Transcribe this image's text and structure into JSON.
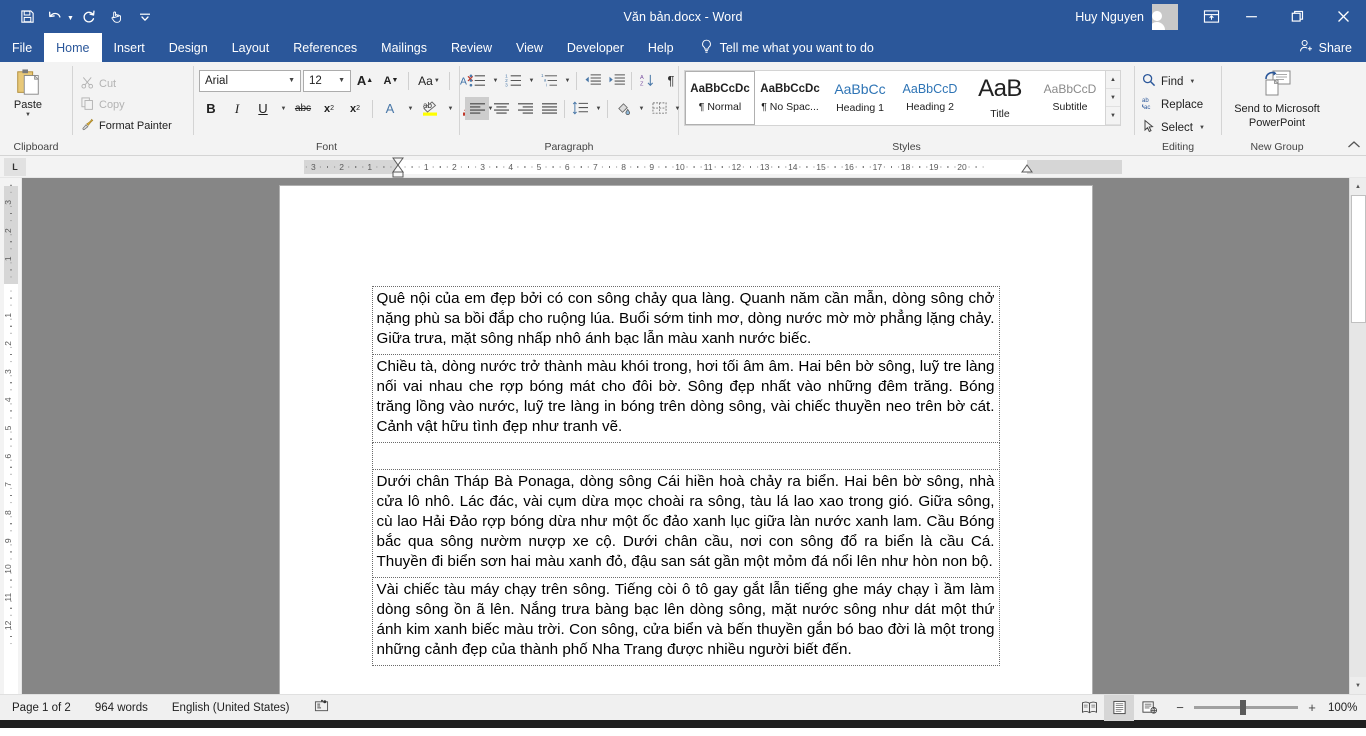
{
  "titlebar": {
    "quick_access": [
      {
        "name": "save-icon",
        "label": "Save"
      },
      {
        "name": "undo-icon",
        "label": "Undo"
      },
      {
        "name": "redo-icon",
        "label": "Redo"
      },
      {
        "name": "touch-mode-icon",
        "label": "Touch/Mouse Mode"
      },
      {
        "name": "customize-qat-icon",
        "label": "Customize Quick Access Toolbar"
      }
    ],
    "document_title": "Văn bản.docx  -  Word",
    "account_name": "Huy Nguyen",
    "ribbon_display_options": "Ribbon Display Options",
    "minimize": "Minimize",
    "restore": "Restore Down",
    "close": "Close"
  },
  "tabs": [
    {
      "label": "File",
      "active": false
    },
    {
      "label": "Home",
      "active": true
    },
    {
      "label": "Insert",
      "active": false
    },
    {
      "label": "Design",
      "active": false
    },
    {
      "label": "Layout",
      "active": false
    },
    {
      "label": "References",
      "active": false
    },
    {
      "label": "Mailings",
      "active": false
    },
    {
      "label": "Review",
      "active": false
    },
    {
      "label": "View",
      "active": false
    },
    {
      "label": "Developer",
      "active": false
    },
    {
      "label": "Help",
      "active": false
    }
  ],
  "tell_me": "Tell me what you want to do",
  "share": "Share",
  "ribbon": {
    "clipboard": {
      "group_label": "Clipboard",
      "paste_label": "Paste",
      "items": [
        {
          "label": "Cut",
          "enabled": false
        },
        {
          "label": "Copy",
          "enabled": false
        },
        {
          "label": "Format Painter",
          "enabled": true
        }
      ]
    },
    "font": {
      "group_label": "Font",
      "font_name": "Arial",
      "font_size": "12",
      "buttons_row1": [
        "Increase Font Size",
        "Decrease Font Size",
        "Change Case",
        "Clear All Formatting"
      ],
      "buttons_row2": [
        "Bold",
        "Italic",
        "Underline",
        "Strikethrough",
        "Subscript",
        "Superscript",
        "Text Effects and Typography",
        "Text Highlight Color",
        "Font Color"
      ],
      "bold_label": "B",
      "italic_label": "I",
      "underline_label": "U",
      "strike_label": "abc",
      "sub_label": "x",
      "sub_sup": "2",
      "super_label": "x",
      "super_sup": "2",
      "grow_label": "A",
      "shrink_label": "A",
      "case_label": "Aa",
      "effects_label": "A",
      "highlight_label": "ab",
      "color_label": "A"
    },
    "paragraph": {
      "group_label": "Paragraph",
      "buttons_row1": [
        "Bullets",
        "Numbering",
        "Multilevel List",
        "Decrease Indent",
        "Increase Indent",
        "Sort",
        "Show/Hide Formatting Marks"
      ],
      "buttons_row2": [
        "Align Left",
        "Center",
        "Align Right",
        "Justify",
        "Line and Paragraph Spacing",
        "Shading",
        "Borders"
      ],
      "pilcrow": "¶"
    },
    "styles": {
      "group_label": "Styles",
      "gallery": [
        {
          "preview": "AaBbCcDc",
          "name": "¶ Normal",
          "active": true,
          "style": "normal"
        },
        {
          "preview": "AaBbCcDc",
          "name": "¶ No Spac...",
          "active": false,
          "style": "nospace"
        },
        {
          "preview": "AaBbCc",
          "name": "Heading 1",
          "active": false,
          "style": "h1"
        },
        {
          "preview": "AaBbCcD",
          "name": "Heading 2",
          "active": false,
          "style": "h2"
        },
        {
          "preview": "AaB",
          "name": "Title",
          "active": false,
          "style": "title"
        },
        {
          "preview": "AaBbCcD",
          "name": "Subtitle",
          "active": false,
          "style": "subtitle"
        }
      ]
    },
    "editing": {
      "group_label": "Editing",
      "items": [
        {
          "label": "Find",
          "icon": "magnifier-icon",
          "caret": true
        },
        {
          "label": "Replace",
          "icon": "replace-icon",
          "caret": false
        },
        {
          "label": "Select",
          "icon": "cursor-icon",
          "caret": true
        }
      ]
    },
    "new_group": {
      "group_label": "New Group",
      "button_label": "Send to Microsoft PowerPoint"
    },
    "collapse_label": "Collapse the Ribbon"
  },
  "ruler": {
    "tab_stop_marker": "L",
    "horizontal_ticks": [
      "2",
      "1",
      "1",
      "2",
      "3",
      "4",
      "5",
      "6",
      "7",
      "8",
      "9",
      "10",
      "11",
      "12",
      "13",
      "14",
      "15",
      "16",
      "17",
      "18",
      "19"
    ],
    "vertical_ticks": [
      "2",
      "1",
      "1",
      "2",
      "3",
      "4",
      "5",
      "6",
      "7",
      "8",
      "9",
      "10"
    ]
  },
  "document": {
    "paragraphs": [
      {
        "id": "p1",
        "text": "Quê nội của em đẹp bởi có con sông chảy qua làng. Quanh năm cần mẫn, dòng sông chở nặng phù sa bồi đắp cho ruộng lúa. Buổi sớm tinh mơ, dòng nước mờ mờ phẳng lặng chảy. Giữa trưa, mặt sông nhấp nhô ánh bạc lẫn màu xanh nước biếc."
      },
      {
        "id": "p2",
        "text": "Chiều tà, dòng nước trở thành màu khói trong, hơi tối âm âm. Hai bên bờ sông, luỹ tre làng nối vai nhau che rợp bóng mát cho đôi bờ. Sông đẹp nhất vào những đêm trăng. Bóng trăng lồng vào nước, luỹ tre làng in bóng trên dòng sông, vài chiếc thuyền neo trên bờ cát. Cảnh vật hữu tình đẹp như tranh vẽ."
      },
      {
        "id": "p3",
        "text": ""
      },
      {
        "id": "p4",
        "text": "Dưới chân Tháp Bà Ponaga, dòng sông Cái hiền hoà chảy ra biển. Hai bên bờ sông, nhà cửa lô nhô. Lác đác, vài cụm dừa mọc choài ra sông, tàu lá lao xao trong gió. Giữa sông, cù lao Hải Đảo rợp bóng dừa như một ốc đảo xanh lục giữa làn nước xanh lam. Cầu Bóng bắc qua sông nườm nượp xe cộ. Dưới chân cầu, nơi con sông đổ ra biển là cầu Cá. Thuyền đi biển sơn hai màu xanh đỏ, đậu san sát gần một mỏm đá nổi lên như hòn non bộ."
      },
      {
        "id": "p5",
        "text": "Vài chiếc tàu máy chạy trên sông. Tiếng còi ô tô gay gắt lẫn tiếng ghe máy chạy ì ầm làm dòng sông ồn ã lên. Nắng trưa bàng bạc lên dòng sông, mặt nước sông như dát một thứ ánh kim xanh biếc màu trời. Con sông, cửa biển và bến thuyền gắn bó bao đời là một trong những cảnh đẹp của thành phố Nha Trang được nhiều người biết đến."
      }
    ]
  },
  "statusbar": {
    "page": "Page 1 of 2",
    "words": "964 words",
    "language": "English (United States)",
    "proofing_icon": "proofing-status-icon",
    "views": [
      {
        "name": "read-mode-icon",
        "label": "Read Mode",
        "active": false
      },
      {
        "name": "print-layout-icon",
        "label": "Print Layout",
        "active": true
      },
      {
        "name": "web-layout-icon",
        "label": "Web Layout",
        "active": false
      }
    ],
    "zoom_out": "−",
    "zoom_in": "+",
    "zoom_percent": "100%"
  },
  "colors": {
    "word_blue": "#2b579a",
    "ribbon_bg": "#f3f3f3",
    "workspace_gray": "#868686",
    "accent_red": "#c0392b"
  }
}
